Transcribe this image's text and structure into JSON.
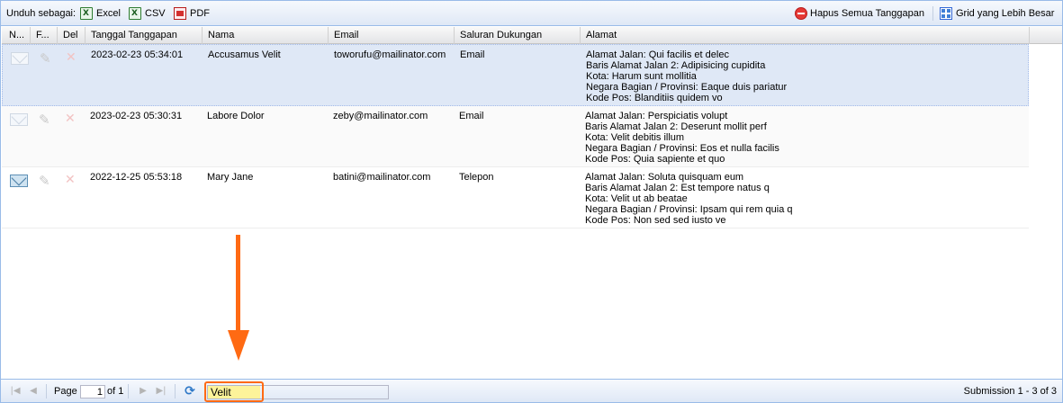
{
  "toolbar": {
    "download_label": "Unduh sebagai:",
    "excel_label": "Excel",
    "csv_label": "CSV",
    "pdf_label": "PDF",
    "delete_all_label": "Hapus Semua Tanggapan",
    "bigger_grid_label": "Grid yang Lebih Besar"
  },
  "columns": {
    "new": "N...",
    "flag": "F...",
    "del": "Del",
    "date": "Tanggal Tanggapan",
    "name": "Nama",
    "email": "Email",
    "channel": "Saluran Dukungan",
    "address": "Alamat"
  },
  "rows": [
    {
      "date": "2023-02-23 05:34:01",
      "name": "Accusamus Velit",
      "email": "toworufu@mailinator.com",
      "channel": "Email",
      "address": [
        "Alamat Jalan: Qui facilis et delec",
        "Baris Alamat Jalan 2: Adipisicing cupidita",
        "Kota: Harum sunt mollitia",
        "Negara Bagian / Provinsi: Eaque duis pariatur",
        "Kode Pos: Blanditiis quidem vo"
      ]
    },
    {
      "date": "2023-02-23 05:30:31",
      "name": "Labore Dolor",
      "email": "zeby@mailinator.com",
      "channel": "Email",
      "address": [
        "Alamat Jalan: Perspiciatis volupt",
        "Baris Alamat Jalan 2: Deserunt mollit perf",
        "Kota: Velit debitis illum",
        "Negara Bagian / Provinsi: Eos et nulla facilis",
        "Kode Pos: Quia sapiente et quo"
      ]
    },
    {
      "date": "2022-12-25 05:53:18",
      "name": "Mary Jane",
      "email": "batini@mailinator.com",
      "channel": "Telepon",
      "address": [
        "Alamat Jalan: Soluta quisquam eum",
        "Baris Alamat Jalan 2: Est tempore natus q",
        "Kota: Velit ut ab beatae",
        "Negara Bagian / Provinsi: Ipsam qui rem quia q",
        "Kode Pos: Non sed sed iusto ve"
      ]
    }
  ],
  "pager": {
    "page_label": "Page",
    "page_value": "1",
    "of_label": "of 1",
    "search_value": "Velit",
    "status": "Submission 1 - 3 of 3"
  },
  "icons": {
    "first": "first-page-icon",
    "prev": "prev-page-icon",
    "next": "next-page-icon",
    "last": "last-page-icon",
    "refresh": "refresh-icon",
    "mail": "envelope-icon",
    "flag": "pen-icon",
    "delete": "delete-x-icon"
  },
  "colors": {
    "accent_annotation": "#ff6a13",
    "selected_row": "#dfe8f6",
    "search_highlight": "#fdf39a"
  }
}
